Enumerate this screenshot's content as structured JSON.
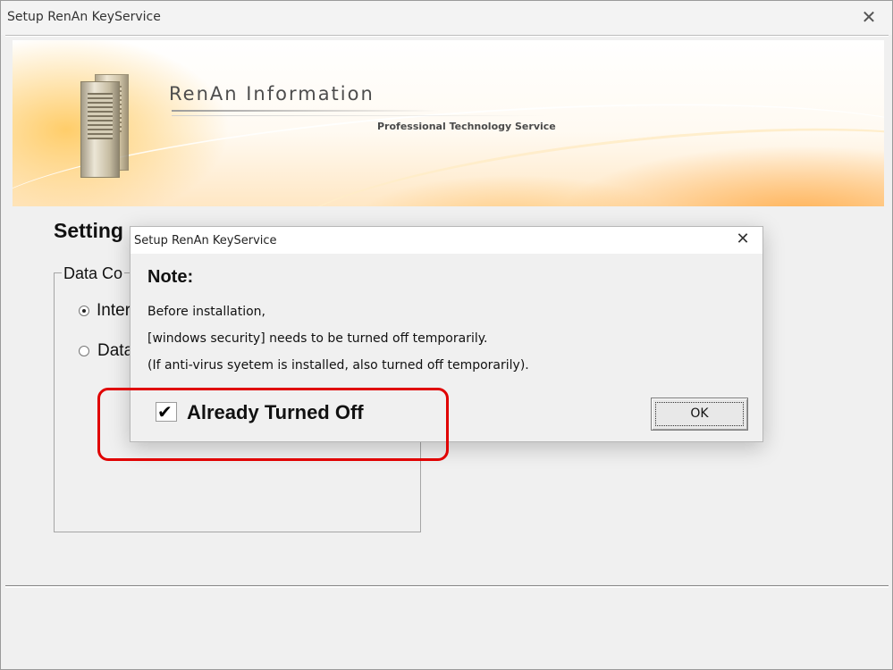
{
  "main_window": {
    "title": "Setup RenAn KeyService",
    "close_glyph": "✕"
  },
  "banner": {
    "company": "RenAn Information",
    "tagline": "Professional Technology Service"
  },
  "settings": {
    "heading": "Setting",
    "group_label": "Data Co",
    "options": [
      {
        "label": "Inter",
        "selected": true
      },
      {
        "label": "Data",
        "selected": false
      }
    ]
  },
  "dialog": {
    "title": "Setup RenAn KeyService",
    "close_glyph": "✕",
    "heading": "Note:",
    "lines": [
      "Before installation,",
      "[windows security] needs to be turned off temporarily.",
      "(If anti-virus syetem is installed, also turned off temporarily)."
    ],
    "checkbox": {
      "label": "Already Turned Off",
      "checked": true,
      "tick_glyph": "✔"
    },
    "ok_label": "OK"
  },
  "annotation": {
    "color": "#e00000"
  }
}
